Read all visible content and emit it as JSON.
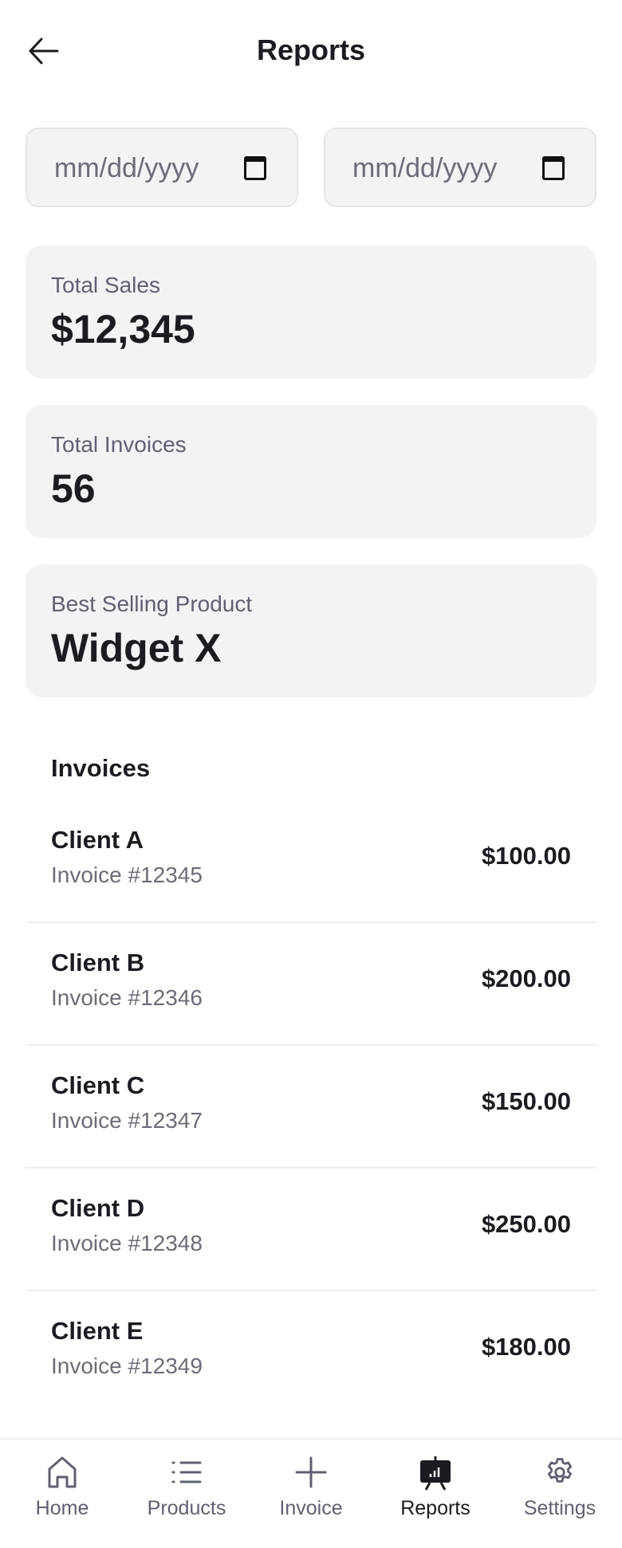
{
  "header": {
    "title": "Reports",
    "back_icon": "arrow-left-icon"
  },
  "filters": {
    "start_date": {
      "placeholder": "mm/dd/yyyy",
      "value": ""
    },
    "end_date": {
      "placeholder": "mm/dd/yyyy",
      "value": ""
    }
  },
  "stats": [
    {
      "label": "Total Sales",
      "value": "$12,345"
    },
    {
      "label": "Total Invoices",
      "value": "56"
    },
    {
      "label": "Best Selling Product",
      "value": "Widget X"
    }
  ],
  "invoices": {
    "heading": "Invoices",
    "items": [
      {
        "client": "Client A",
        "number": "Invoice #12345",
        "amount": "$100.00"
      },
      {
        "client": "Client B",
        "number": "Invoice #12346",
        "amount": "$200.00"
      },
      {
        "client": "Client C",
        "number": "Invoice #12347",
        "amount": "$150.00"
      },
      {
        "client": "Client D",
        "number": "Invoice #12348",
        "amount": "$250.00"
      },
      {
        "client": "Client E",
        "number": "Invoice #12349",
        "amount": "$180.00"
      }
    ]
  },
  "nav": {
    "active": "Reports",
    "items": [
      {
        "label": "Home",
        "icon": "home-icon"
      },
      {
        "label": "Products",
        "icon": "list-icon"
      },
      {
        "label": "Invoice",
        "icon": "plus-icon"
      },
      {
        "label": "Reports",
        "icon": "presentation-chart-icon"
      },
      {
        "label": "Settings",
        "icon": "gear-icon"
      }
    ]
  },
  "colors": {
    "text": "#1b1c21",
    "muted": "#6b6c78",
    "card_bg": "#f2f3f5"
  }
}
